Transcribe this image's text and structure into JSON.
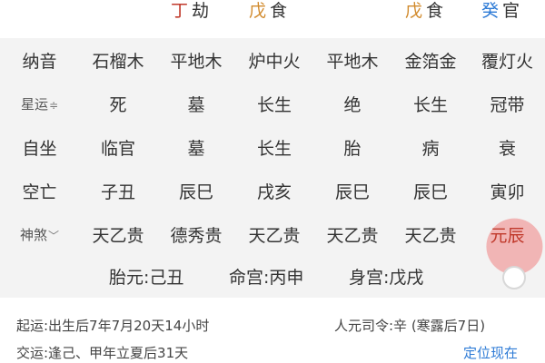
{
  "colors": {
    "ding_red": "#c0392b",
    "wu_orange": "#d18a2c",
    "gui_blue": "#2e7bd6",
    "text": "#333333",
    "table_bg": "#f3f3f3",
    "link": "#2e7bd6"
  },
  "top_row": [
    {
      "stem": "丁",
      "role": "劫"
    },
    {
      "stem": "戊",
      "role": "食"
    },
    {
      "stem": "戊",
      "role": "食"
    },
    {
      "stem": "癸",
      "role": "官"
    }
  ],
  "rows": [
    {
      "label": "纳音",
      "cells": [
        "石榴木",
        "平地木",
        "炉中火",
        "平地木",
        "金箔金",
        "覆灯火"
      ]
    },
    {
      "label": "星运",
      "label_suffix": "≑",
      "cells": [
        "死",
        "墓",
        "长生",
        "绝",
        "长生",
        "冠带"
      ]
    },
    {
      "label": "自坐",
      "cells": [
        "临官",
        "墓",
        "长生",
        "胎",
        "病",
        "衰"
      ]
    },
    {
      "label": "空亡",
      "cells": [
        "子丑",
        "辰巳",
        "戌亥",
        "辰巳",
        "辰巳",
        "寅卯"
      ]
    },
    {
      "label": "神煞",
      "label_suffix": "﹀",
      "cells": [
        "天乙贵",
        "德秀贵",
        "天乙贵",
        "天乙贵",
        "天乙贵",
        "元辰"
      ]
    }
  ],
  "palaces": {
    "tai_yuan": "胎元:己丑",
    "ming_gong": "命宫:丙申",
    "shen_gong": "身宫:戊戌"
  },
  "footer": {
    "qi_yun": "起运:出生后7年7月20天14小时",
    "ren_yuan": "人元司令:辛 (寒露后7日)",
    "jiao_yun": "交运:逢己、甲年立夏后31天",
    "locate_now": "定位现在"
  }
}
